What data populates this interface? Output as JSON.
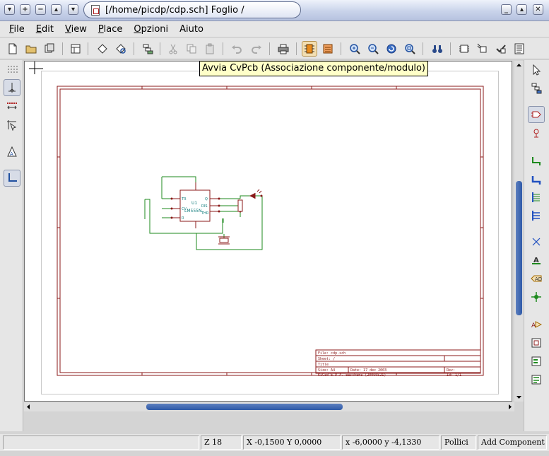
{
  "window": {
    "title": "[/home/picdp/cdp.sch]  Foglio /"
  },
  "title_buttons_left": [
    "window-menu-icon",
    "maximize-icon",
    "minimize-icon",
    "shade-icon",
    "dropdown-icon"
  ],
  "title_buttons_right": [
    "minimize-icon",
    "maximize-icon",
    "close-icon"
  ],
  "menu": {
    "items": [
      {
        "accel": "F",
        "rest": "ile"
      },
      {
        "accel": "E",
        "rest": "dit"
      },
      {
        "accel": "V",
        "rest": "iew"
      },
      {
        "accel": "P",
        "rest": "lace"
      },
      {
        "accel": "O",
        "rest": "pzioni"
      },
      {
        "accel": "",
        "rest": "Aiuto"
      }
    ]
  },
  "toolbar": {
    "icons": [
      "new-schematic-icon",
      "open-folder-icon",
      "save-icon",
      "sheet-settings-icon",
      "hierarchy-navigator-icon",
      "find-icon",
      "netlist-icon",
      "cut-icon",
      "copy-icon",
      "paste-icon",
      "undo-icon",
      "redo-icon",
      "print-icon",
      "cvpcb-icon",
      "pcbnew-icon",
      "zoom-in-icon",
      "zoom-out-icon",
      "redraw-icon",
      "zoom-fit-icon",
      "find-binoculars-icon",
      "library-editor-icon",
      "annotate-icon",
      "erc-icon",
      "bom-icon"
    ]
  },
  "tooltip": {
    "text": "Avvia CvPcb (Associazione componente/modulo)"
  },
  "left_toolbar": {
    "icons": [
      "grid-toggle-icon",
      "units-inch-icon",
      "units-mm-icon",
      "cursor-shape-icon",
      "hidden-pins-icon",
      "wire-angle-icon"
    ]
  },
  "right_toolbar": {
    "icons": [
      "select-arrow-icon",
      "navigate-hierarchy-icon",
      "add-component-icon",
      "add-power-icon",
      "add-wire-icon",
      "add-bus-icon",
      "wire-to-bus-entry-icon",
      "bus-to-bus-entry-icon",
      "no-connect-icon",
      "add-net-label-icon",
      "add-global-label-icon",
      "add-junction-icon",
      "add-hierarchical-label-icon",
      "add-sheet-icon",
      "import-sheet-pin-icon",
      "add-sheet-pin-icon"
    ]
  },
  "schematic": {
    "component_ref": "U1",
    "component_value": "LM555N",
    "pins_left": [
      "TR",
      "CV",
      "R"
    ],
    "pins_right": [
      "Q",
      "DIS",
      "THR"
    ],
    "title_block": {
      "line1": "File: cdp.sch",
      "line2": "Sheet: /",
      "line3": "Title",
      "size": "Size: A4",
      "date": "Date: 17 dec 2003",
      "rev": "Rev:",
      "kicad": "KiCad E.D.A.  eeschema (20060521)",
      "id": "Id: 1/1"
    }
  },
  "status": {
    "blank": "",
    "zoom": "Z 18",
    "abs_coords": "X -0,1500  Y 0,0000",
    "rel_coords": "x -6,0000  y -4,1330",
    "units": "Pollici",
    "mode": "Add Component"
  },
  "colors": {
    "sheet_border": "#8b1a1a",
    "wire": "#1e8a1e",
    "component": "#8b1a1a",
    "pin_text": "#127d7d",
    "scroll_thumb": "#2e5aa8",
    "tooltip_bg": "#ffffc8",
    "active_toolbar": "#f3dfb2"
  },
  "scroll": {
    "vertical_fraction": 0.59,
    "horizontal_fraction": 0.41
  }
}
